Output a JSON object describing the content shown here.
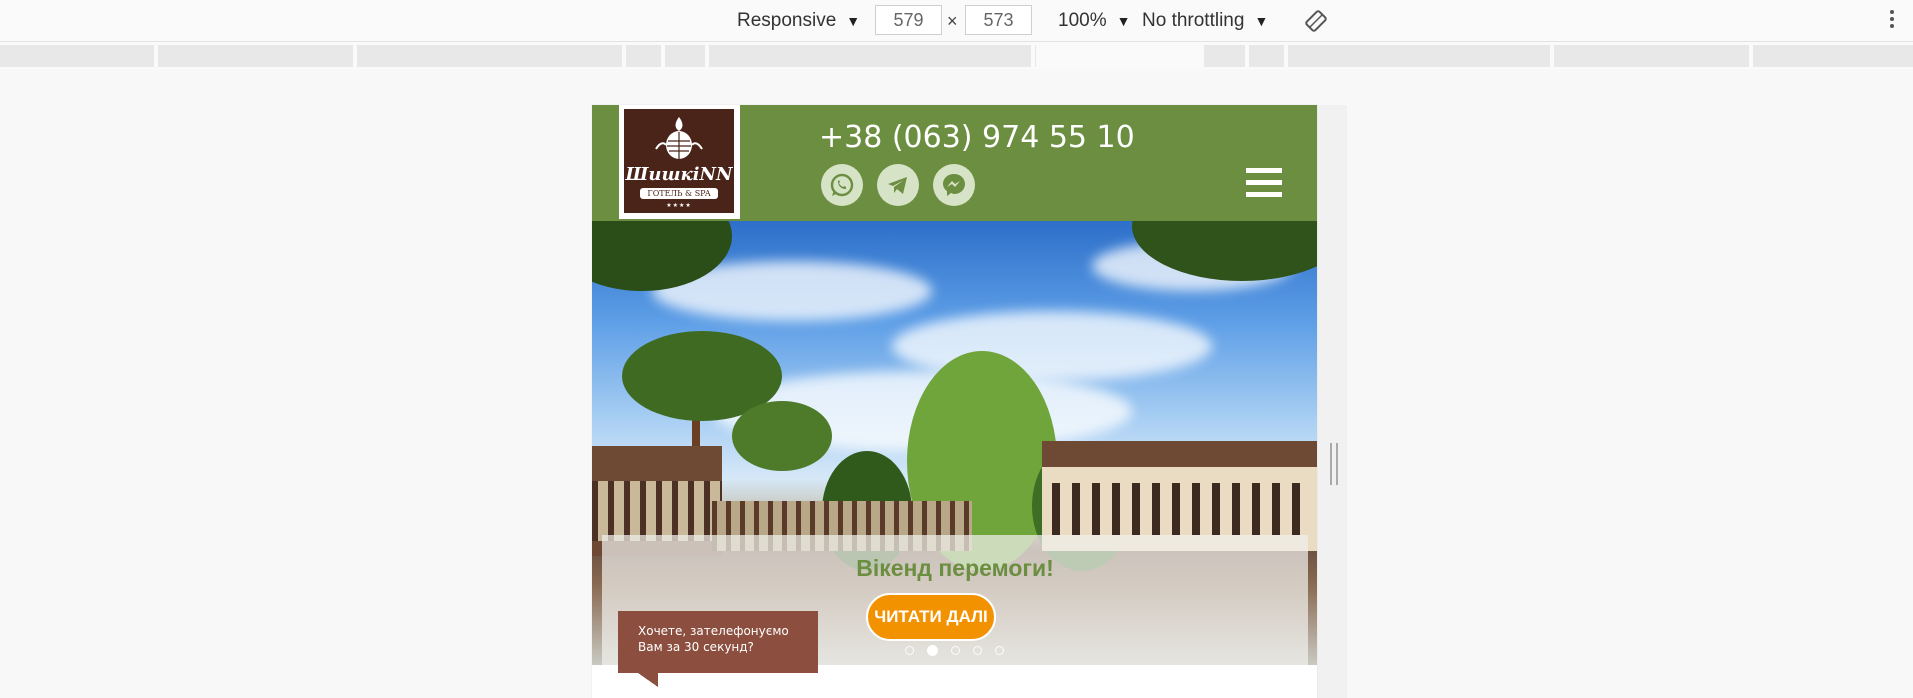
{
  "devtools": {
    "device_mode": "Responsive",
    "width": "579",
    "height": "573",
    "dimension_separator": "×",
    "zoom": "100%",
    "throttling": "No throttling",
    "caret": "▼"
  },
  "site": {
    "logo_name": "ШишкiNN",
    "logo_sub": "ГОТЕЛЬ & SPA",
    "logo_stars": "★★★★",
    "phone": "+38 (063) 974 55 10",
    "social": [
      "whatsapp-icon",
      "telegram-icon",
      "messenger-icon"
    ],
    "colors": {
      "header": "#6b8e41",
      "accent": "#f39200",
      "callback": "#8c4f3f",
      "logo_bg": "#4a2419"
    }
  },
  "hero": {
    "title": "Вікенд перемоги!",
    "button_label": "ЧИТАТИ ДАЛІ",
    "slide_count": 5,
    "active_slide": 2
  },
  "callback": {
    "line1": "Хочете, зателефонуємо",
    "line2": "Вам за 30 секунд?"
  }
}
